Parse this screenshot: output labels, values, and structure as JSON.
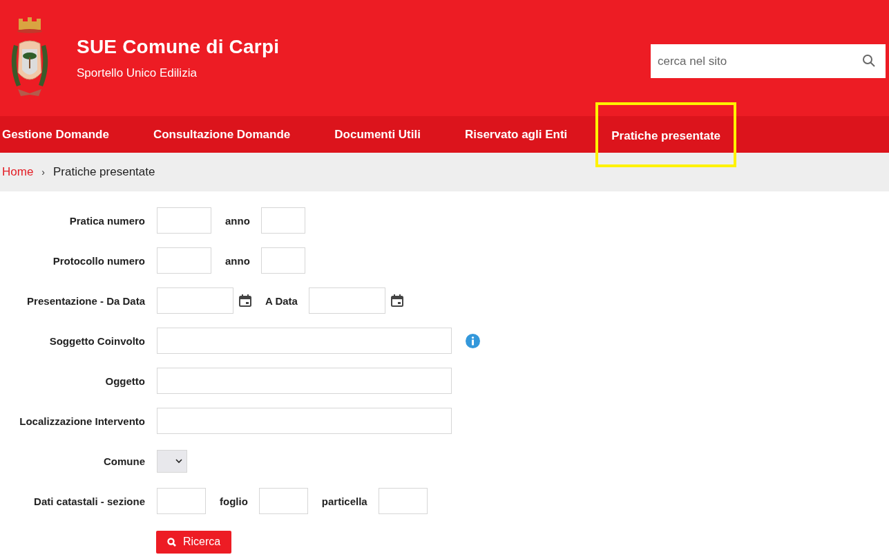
{
  "header": {
    "title": "SUE Comune di Carpi",
    "subtitle": "Sportello Unico Edilizia",
    "search": {
      "placeholder": "cerca nel sito"
    }
  },
  "nav": [
    {
      "label": "Gestione Domande",
      "highlighted": false
    },
    {
      "label": "Consultazione Domande",
      "highlighted": false
    },
    {
      "label": "Documenti Utili",
      "highlighted": false
    },
    {
      "label": "Riservato agli Enti",
      "highlighted": false
    },
    {
      "label": "Pratiche presentate",
      "highlighted": true
    }
  ],
  "breadcrumb": [
    {
      "label": "Home",
      "kind": "link"
    },
    {
      "label": "Pratiche presentate",
      "kind": "current"
    }
  ],
  "breadcrumb_separator": "›",
  "form": {
    "rows": [
      {
        "label": "Pratica numero",
        "items": [
          {
            "kind": "number"
          },
          {
            "kind": "label",
            "text": "anno"
          },
          {
            "kind": "year"
          }
        ]
      },
      {
        "label": "Protocollo numero",
        "items": [
          {
            "kind": "number"
          },
          {
            "kind": "label",
            "text": "anno"
          },
          {
            "kind": "year"
          }
        ]
      },
      {
        "label": "Presentazione - Da Data",
        "items": [
          {
            "kind": "date"
          },
          {
            "kind": "label",
            "text": "A Data"
          },
          {
            "kind": "date"
          }
        ]
      },
      {
        "label": "Soggetto Coinvolto",
        "items": [
          {
            "kind": "text"
          },
          {
            "kind": "info"
          }
        ]
      },
      {
        "label": "Oggetto",
        "items": [
          {
            "kind": "text"
          }
        ]
      },
      {
        "label": "Localizzazione Intervento",
        "items": [
          {
            "kind": "text"
          }
        ]
      },
      {
        "label": "Comune",
        "items": [
          {
            "kind": "select"
          }
        ]
      },
      {
        "label": "Dati catastali - sezione",
        "items": [
          {
            "kind": "code"
          },
          {
            "kind": "label",
            "text": "foglio"
          },
          {
            "kind": "code"
          },
          {
            "kind": "label",
            "text": "particella"
          },
          {
            "kind": "code"
          }
        ]
      }
    ],
    "submit": "Ricerca"
  }
}
